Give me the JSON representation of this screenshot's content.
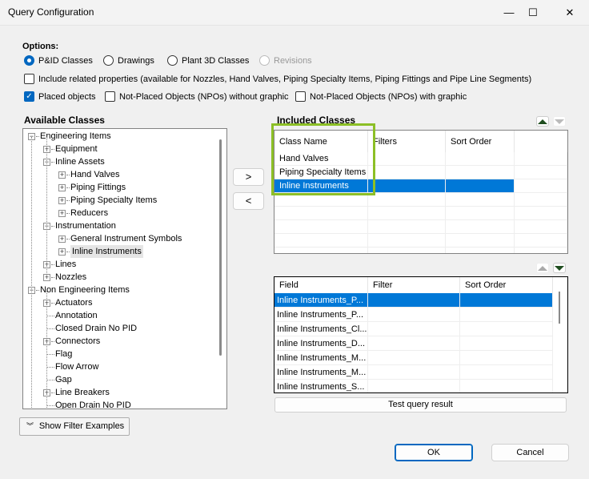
{
  "window": {
    "title": "Query Configuration",
    "minimize": "—",
    "maximize": "☐",
    "close": "✕"
  },
  "options": {
    "label": "Options:",
    "radios": [
      {
        "label": "P&ID Classes",
        "checked": true
      },
      {
        "label": "Drawings",
        "checked": false
      },
      {
        "label": "Plant 3D Classes",
        "checked": false
      },
      {
        "label": "Revisions",
        "checked": false,
        "disabled": true
      }
    ],
    "include_related": {
      "label": "Include related properties (available for Nozzles, Hand Valves, Piping Specialty Items, Piping Fittings and Pipe Line Segments)",
      "checked": false
    },
    "placed": {
      "label": "Placed objects",
      "checked": true
    },
    "npo_without": {
      "label": "Not-Placed Objects (NPOs) without graphic",
      "checked": false
    },
    "npo_with": {
      "label": "Not-Placed Objects (NPOs) with graphic",
      "checked": false
    }
  },
  "available": {
    "title": "Available Classes",
    "tree": [
      {
        "label": "Engineering Items",
        "level": 0,
        "exp": "minus"
      },
      {
        "label": "Equipment",
        "level": 1,
        "exp": "plus"
      },
      {
        "label": "Inline Assets",
        "level": 1,
        "exp": "minus"
      },
      {
        "label": "Hand Valves",
        "level": 2,
        "exp": "plus"
      },
      {
        "label": "Piping Fittings",
        "level": 2,
        "exp": "plus"
      },
      {
        "label": "Piping Specialty Items",
        "level": 2,
        "exp": "plus"
      },
      {
        "label": "Reducers",
        "level": 2,
        "exp": "plus"
      },
      {
        "label": "Instrumentation",
        "level": 1,
        "exp": "minus"
      },
      {
        "label": "General Instrument Symbols",
        "level": 2,
        "exp": "plus"
      },
      {
        "label": "Inline Instruments",
        "level": 2,
        "exp": "plus",
        "hover": true
      },
      {
        "label": "Lines",
        "level": 1,
        "exp": "plus"
      },
      {
        "label": "Nozzles",
        "level": 1,
        "exp": "plus"
      },
      {
        "label": "Non Engineering Items",
        "level": 0,
        "exp": "minus"
      },
      {
        "label": "Actuators",
        "level": 1,
        "exp": "plus"
      },
      {
        "label": "Annotation",
        "level": 1,
        "exp": "none"
      },
      {
        "label": "Closed Drain No PID",
        "level": 1,
        "exp": "none"
      },
      {
        "label": "Connectors",
        "level": 1,
        "exp": "plus"
      },
      {
        "label": "Flag",
        "level": 1,
        "exp": "none"
      },
      {
        "label": "Flow Arrow",
        "level": 1,
        "exp": "none"
      },
      {
        "label": "Gap",
        "level": 1,
        "exp": "none"
      },
      {
        "label": "Line Breakers",
        "level": 1,
        "exp": "plus"
      },
      {
        "label": "Open Drain No PID",
        "level": 1,
        "exp": "none"
      }
    ]
  },
  "transfer": {
    "add": ">",
    "remove": "<"
  },
  "included": {
    "title": "Included Classes",
    "columns": [
      "Class Name",
      "Filters",
      "Sort Order"
    ],
    "rows": [
      "Hand Valves",
      "Piping Specialty Items",
      "Inline Instruments"
    ],
    "selected_index": 2,
    "highlight_color": "#8cbf26"
  },
  "fields": {
    "columns": [
      "Field",
      "Filter",
      "Sort Order"
    ],
    "rows": [
      "Inline Instruments_P...",
      "Inline Instruments_P...",
      "Inline Instruments_Cl...",
      "Inline Instruments_D...",
      "Inline Instruments_M...",
      "Inline Instruments_M...",
      "Inline Instruments_S..."
    ],
    "selected_index": 0
  },
  "test_query": "Test query result",
  "show_filter": "Show Filter Examples",
  "ok": "OK",
  "cancel": "Cancel",
  "colors": {
    "accent": "#0078d7",
    "highlight_box": "#8cbf26"
  }
}
